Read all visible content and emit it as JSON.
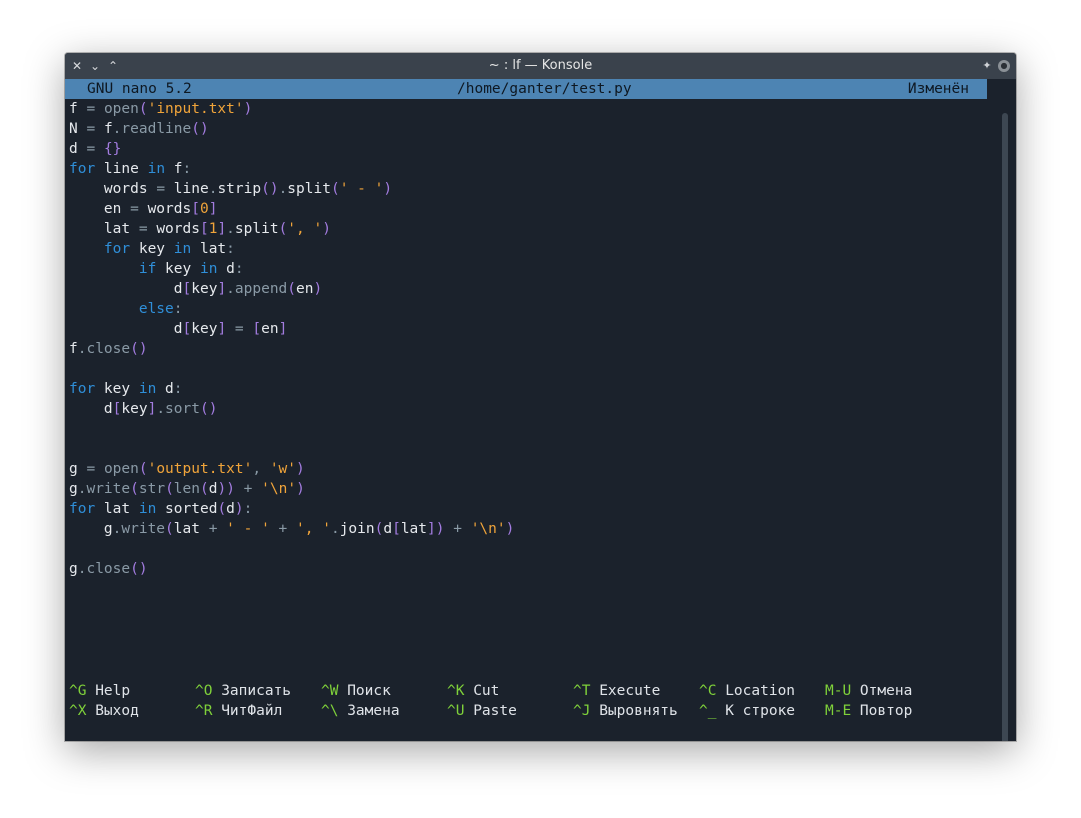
{
  "window": {
    "title": "~ : lf — Konsole",
    "controls": {
      "close": "✕",
      "minimize": "⌄",
      "maximize": "⌃",
      "pin": "📌"
    }
  },
  "nano": {
    "version": "GNU nano 5.2",
    "filename": "/home/ganter/test.py",
    "status": "Изменён"
  },
  "code_lines": [
    [
      [
        "plain",
        "f "
      ],
      [
        "fn",
        "= "
      ],
      [
        "fn",
        "open"
      ],
      [
        "brk",
        "("
      ],
      [
        "str",
        "'input.txt'"
      ],
      [
        "brk",
        ")"
      ]
    ],
    [
      [
        "plain",
        "N "
      ],
      [
        "fn",
        "= "
      ],
      [
        "plain",
        "f"
      ],
      [
        "fn",
        ".readline"
      ],
      [
        "brk",
        "()"
      ]
    ],
    [
      [
        "plain",
        "d "
      ],
      [
        "fn",
        "= "
      ],
      [
        "brk",
        "{}"
      ]
    ],
    [
      [
        "kw",
        "for"
      ],
      [
        "plain",
        " line "
      ],
      [
        "kw",
        "in"
      ],
      [
        "plain",
        " f"
      ],
      [
        "fn",
        ":"
      ]
    ],
    [
      [
        "plain",
        "    words "
      ],
      [
        "fn",
        "= "
      ],
      [
        "plain",
        "line"
      ],
      [
        "fn",
        "."
      ],
      [
        "plain",
        "strip"
      ],
      [
        "brk",
        "()"
      ],
      [
        "fn",
        "."
      ],
      [
        "plain",
        "split"
      ],
      [
        "brk",
        "("
      ],
      [
        "str",
        "' - '"
      ],
      [
        "brk",
        ")"
      ]
    ],
    [
      [
        "plain",
        "    en "
      ],
      [
        "fn",
        "= "
      ],
      [
        "plain",
        "words"
      ],
      [
        "brk",
        "["
      ],
      [
        "str",
        "0"
      ],
      [
        "brk",
        "]"
      ]
    ],
    [
      [
        "plain",
        "    lat "
      ],
      [
        "fn",
        "= "
      ],
      [
        "plain",
        "words"
      ],
      [
        "brk",
        "["
      ],
      [
        "str",
        "1"
      ],
      [
        "brk",
        "]"
      ],
      [
        "fn",
        "."
      ],
      [
        "plain",
        "split"
      ],
      [
        "brk",
        "("
      ],
      [
        "str",
        "', '"
      ],
      [
        "brk",
        ")"
      ]
    ],
    [
      [
        "kw",
        "    for"
      ],
      [
        "plain",
        " key "
      ],
      [
        "kw",
        "in"
      ],
      [
        "plain",
        " lat"
      ],
      [
        "fn",
        ":"
      ]
    ],
    [
      [
        "kw",
        "        if"
      ],
      [
        "plain",
        " key "
      ],
      [
        "kw",
        "in"
      ],
      [
        "plain",
        " d"
      ],
      [
        "fn",
        ":"
      ]
    ],
    [
      [
        "plain",
        "            d"
      ],
      [
        "brk",
        "["
      ],
      [
        "plain",
        "key"
      ],
      [
        "brk",
        "]"
      ],
      [
        "fn",
        ".append"
      ],
      [
        "brk",
        "("
      ],
      [
        "plain",
        "en"
      ],
      [
        "brk",
        ")"
      ]
    ],
    [
      [
        "kw",
        "        else"
      ],
      [
        "fn",
        ":"
      ]
    ],
    [
      [
        "plain",
        "            d"
      ],
      [
        "brk",
        "["
      ],
      [
        "plain",
        "key"
      ],
      [
        "brk",
        "]"
      ],
      [
        "fn",
        " = "
      ],
      [
        "brk",
        "["
      ],
      [
        "plain",
        "en"
      ],
      [
        "brk",
        "]"
      ]
    ],
    [
      [
        "plain",
        "f"
      ],
      [
        "fn",
        ".close"
      ],
      [
        "brk",
        "()"
      ]
    ],
    [],
    [
      [
        "kw",
        "for"
      ],
      [
        "plain",
        " key "
      ],
      [
        "kw",
        "in"
      ],
      [
        "plain",
        " d"
      ],
      [
        "fn",
        ":"
      ]
    ],
    [
      [
        "plain",
        "    d"
      ],
      [
        "brk",
        "["
      ],
      [
        "plain",
        "key"
      ],
      [
        "brk",
        "]"
      ],
      [
        "fn",
        ".sort"
      ],
      [
        "brk",
        "()"
      ]
    ],
    [],
    [],
    [
      [
        "plain",
        "g "
      ],
      [
        "fn",
        "= "
      ],
      [
        "fn",
        "open"
      ],
      [
        "brk",
        "("
      ],
      [
        "str",
        "'output.txt'"
      ],
      [
        "fn",
        ", "
      ],
      [
        "str",
        "'w'"
      ],
      [
        "brk",
        ")"
      ]
    ],
    [
      [
        "plain",
        "g"
      ],
      [
        "fn",
        ".write"
      ],
      [
        "brk",
        "("
      ],
      [
        "fn",
        "str"
      ],
      [
        "brk",
        "("
      ],
      [
        "fn",
        "len"
      ],
      [
        "brk",
        "("
      ],
      [
        "plain",
        "d"
      ],
      [
        "brk",
        "))"
      ],
      [
        "fn",
        " + "
      ],
      [
        "str",
        "'\\n'"
      ],
      [
        "brk",
        ")"
      ]
    ],
    [
      [
        "kw",
        "for"
      ],
      [
        "plain",
        " lat "
      ],
      [
        "kw",
        "in"
      ],
      [
        "plain",
        " sorted"
      ],
      [
        "brk",
        "("
      ],
      [
        "plain",
        "d"
      ],
      [
        "brk",
        ")"
      ],
      [
        "fn",
        ":"
      ]
    ],
    [
      [
        "plain",
        "    g"
      ],
      [
        "fn",
        ".write"
      ],
      [
        "brk",
        "("
      ],
      [
        "plain",
        "lat "
      ],
      [
        "fn",
        "+ "
      ],
      [
        "str",
        "' - '"
      ],
      [
        "fn",
        " + "
      ],
      [
        "str",
        "', '"
      ],
      [
        "fn",
        "."
      ],
      [
        "plain",
        "join"
      ],
      [
        "brk",
        "("
      ],
      [
        "plain",
        "d"
      ],
      [
        "brk",
        "["
      ],
      [
        "plain",
        "lat"
      ],
      [
        "brk",
        "])"
      ],
      [
        "fn",
        " + "
      ],
      [
        "str",
        "'\\n'"
      ],
      [
        "brk",
        ")"
      ]
    ],
    [],
    [
      [
        "plain",
        "g"
      ],
      [
        "fn",
        ".close"
      ],
      [
        "brk",
        "()"
      ]
    ]
  ],
  "shortcuts": {
    "row1": [
      {
        "key": "^G",
        "label": "Help"
      },
      {
        "key": "^O",
        "label": "Записать"
      },
      {
        "key": "^W",
        "label": "Поиск"
      },
      {
        "key": "^K",
        "label": "Cut"
      },
      {
        "key": "^T",
        "label": "Execute"
      },
      {
        "key": "^C",
        "label": "Location"
      },
      {
        "key": "M-U",
        "label": "Отмена"
      }
    ],
    "row2": [
      {
        "key": "^X",
        "label": "Выход"
      },
      {
        "key": "^R",
        "label": "ЧитФайл"
      },
      {
        "key": "^\\",
        "label": "Замена"
      },
      {
        "key": "^U",
        "label": "Paste"
      },
      {
        "key": "^J",
        "label": "Выровнять"
      },
      {
        "key": "^_",
        "label": "К строке"
      },
      {
        "key": "M-E",
        "label": "Повтор"
      }
    ]
  },
  "colors": {
    "header_bg": "#4d84b3",
    "terminal_bg": "#1b222c",
    "keyword": "#2f8fd9",
    "string": "#f0a43a",
    "bracket": "#a37ce0",
    "shortcut_key": "#7fd13a"
  }
}
